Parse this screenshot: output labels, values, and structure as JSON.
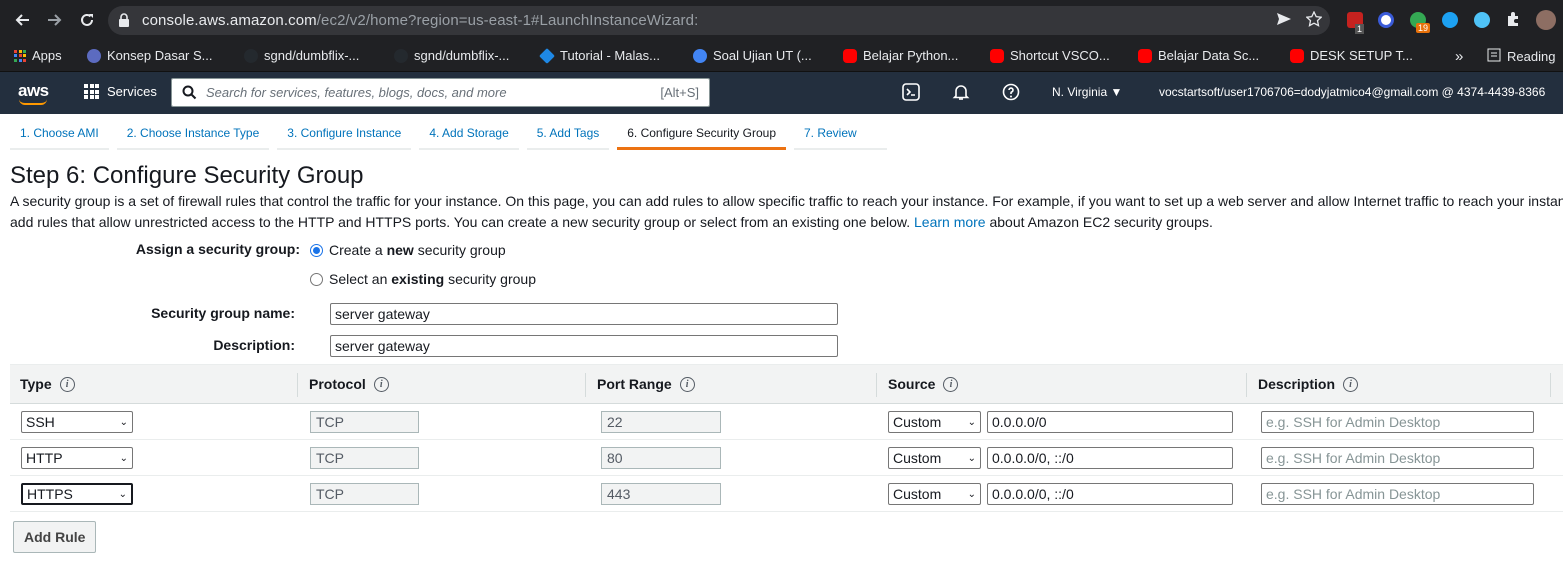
{
  "browser": {
    "url_host": "console.aws.amazon.com",
    "url_path": "/ec2/v2/home?region=us-east-1#LaunchInstanceWizard:",
    "ext_badge_1": "1",
    "ext_badge_2": "19"
  },
  "bookmarks": {
    "items": [
      {
        "label": "Apps"
      },
      {
        "label": "Konsep Dasar S..."
      },
      {
        "label": "sgnd/dumbflix-..."
      },
      {
        "label": "sgnd/dumbflix-..."
      },
      {
        "label": "Tutorial - Malas..."
      },
      {
        "label": "Soal Ujian UT (..."
      },
      {
        "label": "Belajar Python..."
      },
      {
        "label": "Shortcut VSCO..."
      },
      {
        "label": "Belajar Data Sc..."
      },
      {
        "label": "DESK SETUP T..."
      }
    ],
    "overflow": "»",
    "reading_list": "Reading"
  },
  "aws": {
    "logo": "aws",
    "services": "Services",
    "search_placeholder": "Search for services, features, blogs, docs, and more",
    "search_shortcut": "[Alt+S]",
    "region": "N. Virginia ▼",
    "account": "vocstartsoft/user1706706=dodyjatmico4@gmail.com @ 4374-4439-8366"
  },
  "wizard": {
    "tabs": [
      {
        "label": "1. Choose AMI"
      },
      {
        "label": "2. Choose Instance Type"
      },
      {
        "label": "3. Configure Instance"
      },
      {
        "label": "4. Add Storage"
      },
      {
        "label": "5. Add Tags"
      },
      {
        "label": "6. Configure Security Group"
      },
      {
        "label": "7. Review"
      }
    ],
    "active_tab": 5
  },
  "page": {
    "title": "Step 6: Configure Security Group",
    "intro_1": "A security group is a set of firewall rules that control the traffic for your instance. On this page, you can add rules to allow specific traffic to reach your instance. For example, if you want to set up a web server and allow Internet traffic to reach your instance,",
    "intro_2": "add rules that allow unrestricted access to the HTTP and HTTPS ports. You can create a new security group or select from an existing one below.",
    "learn_more": "Learn more",
    "intro_3": "about Amazon EC2 security groups.",
    "assign_label": "Assign a security group:",
    "radio_new_pre": "Create a",
    "radio_new_bold": "new",
    "radio_new_post": "security group",
    "radio_existing_pre": "Select an",
    "radio_existing_bold": "existing",
    "radio_existing_post": "security group",
    "sg_name_label": "Security group name:",
    "sg_name_value": "server gateway",
    "desc_label": "Description:",
    "desc_value": "server gateway"
  },
  "table": {
    "headers": {
      "type": "Type",
      "protocol": "Protocol",
      "port_range": "Port Range",
      "source": "Source",
      "description": "Description"
    },
    "rows": [
      {
        "type": "SSH",
        "protocol": "TCP",
        "port": "22",
        "source_mode": "Custom",
        "source": "0.0.0.0/0",
        "desc_placeholder": "e.g. SSH for Admin Desktop"
      },
      {
        "type": "HTTP",
        "protocol": "TCP",
        "port": "80",
        "source_mode": "Custom",
        "source": "0.0.0.0/0, ::/0",
        "desc_placeholder": "e.g. SSH for Admin Desktop"
      },
      {
        "type": "HTTPS",
        "protocol": "TCP",
        "port": "443",
        "source_mode": "Custom",
        "source": "0.0.0.0/0, ::/0",
        "desc_placeholder": "e.g. SSH for Admin Desktop"
      }
    ],
    "add_rule": "Add Rule"
  }
}
